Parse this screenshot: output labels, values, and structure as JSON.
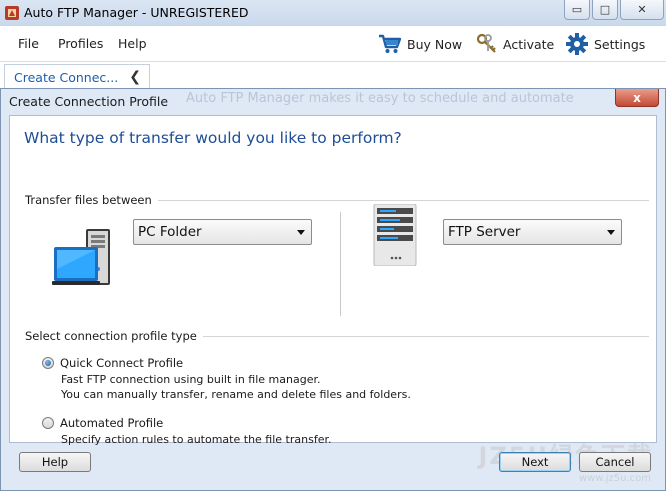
{
  "window": {
    "title": "Auto FTP Manager - UNREGISTERED",
    "controls": {
      "minimize": "▭",
      "maximize": "□",
      "close": "✕"
    }
  },
  "menu": {
    "items": [
      "File",
      "Profiles",
      "Help"
    ]
  },
  "toolbar": {
    "buy_now": "Buy Now",
    "activate": "Activate",
    "settings": "Settings"
  },
  "side_tab": {
    "label": "Create Connec...",
    "collapse_glyph": "❮"
  },
  "dialog": {
    "title": "Create Connection Profile",
    "background_text": "Auto FTP Manager makes it easy to schedule and automate",
    "close_glyph": "x",
    "question": "What type of transfer would you like to perform?",
    "transfer_group_label": "Transfer files between",
    "source_select": {
      "value": "PC Folder",
      "icon": "pc-icon"
    },
    "target_select": {
      "value": "FTP Server",
      "icon": "server-icon"
    },
    "profile_group_label": "Select connection profile type",
    "options": [
      {
        "label": "Quick Connect Profile",
        "selected": true,
        "description": [
          "Fast FTP connection using built in file manager.",
          "You can manually transfer, rename and delete files and folders."
        ]
      },
      {
        "label": "Automated Profile",
        "selected": false,
        "description": [
          "Specify action rules to automate the file transfer."
        ]
      }
    ],
    "buttons": {
      "help": "Help",
      "next": "Next",
      "cancel": "Cancel"
    }
  },
  "watermark": {
    "text": "JZ5U绿色下载",
    "sub": "www.jz5u.com"
  },
  "colors": {
    "accent": "#1e4e96",
    "tab_text": "#1a5fa8",
    "dialog_bg": "#dfe9f6",
    "close_red": "#c24a33"
  }
}
